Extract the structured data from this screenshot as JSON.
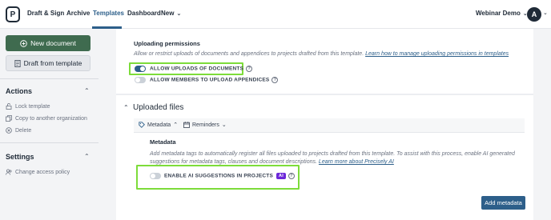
{
  "nav": {
    "logo_letter": "P",
    "items": [
      "Draft & Sign",
      "Archive",
      "Templates",
      "Dashboard",
      "New"
    ],
    "active_index": 2,
    "workspace": "Webinar Demo",
    "avatar_initial": "A"
  },
  "sidebar": {
    "new_document": "New document",
    "draft_from_template": "Draft from template",
    "actions_heading": "Actions",
    "actions": [
      "Lock template",
      "Copy to another organization",
      "Delete"
    ],
    "settings_heading": "Settings",
    "settings": [
      "Change access policy"
    ]
  },
  "permissions": {
    "title": "Uploading permissions",
    "description": "Allow or restrict uploads of documents and appendices to projects drafted from this template.",
    "link": "Learn how to manage uploading permissions in templates",
    "allow_uploads_label": "ALLOW UPLOADS OF DOCUMENTS",
    "allow_uploads_on": true,
    "allow_appendices_label": "ALLOW MEMBERS TO UPLOAD APPENDICES",
    "allow_appendices_on": false
  },
  "uploaded_files": {
    "title": "Uploaded files",
    "tabs": [
      "Metadata",
      "Reminders"
    ],
    "metadata_title": "Metadata",
    "metadata_desc": "Add metadata tags to automatically register all files uploaded to projects drafted from this template. To assist with this process, enable AI generated suggestions for metadata tags, clauses and document descriptions.",
    "metadata_link": "Learn more about Precisely AI",
    "ai_toggle_label": "ENABLE AI SUGGESTIONS IN PROJECTS",
    "ai_badge": "AI",
    "ai_toggle_on": false,
    "add_button": "Add metadata"
  },
  "colors": {
    "accent": "#2d5f8a",
    "primary_green": "#3f6b4f",
    "highlight": "#7ddc3a",
    "ai_badge": "#6d28d9"
  }
}
